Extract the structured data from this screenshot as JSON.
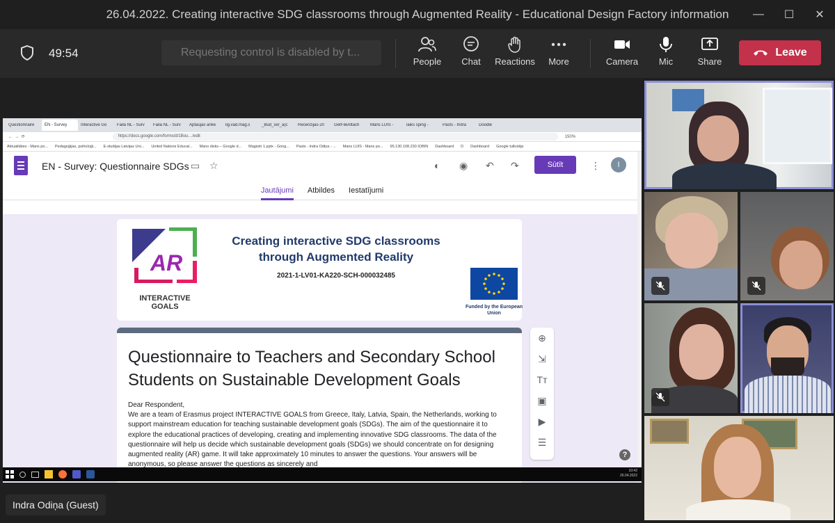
{
  "window": {
    "title": "26.04.2022. Creating interactive SDG classrooms through Augmented Reality - Educational Design Factory information",
    "controls": [
      "—",
      "☐",
      "✕"
    ]
  },
  "meeting": {
    "timer": "49:54",
    "request_control": "Requesting control is disabled by t...",
    "controls": {
      "people": "People",
      "chat": "Chat",
      "reactions": "Reactions",
      "more": "More",
      "camera": "Camera",
      "mic": "Mic",
      "share": "Share",
      "leave": "Leave"
    },
    "presenter_name": "Indra Odiņa (Guest)",
    "colors": {
      "leave": "#c4314b",
      "speaking_outline": "#8b8fd6",
      "bar": "#292929"
    }
  },
  "browser": {
    "tabs": [
      "Questionnaire",
      "EN - Survey",
      "Interactive Go",
      "Faila NL - Surv",
      "Faila NL - Surv",
      "Aptaujas anke",
      "lig.vad.mag.s",
      "_Bud_ser_a(c",
      "Recenzijas-20",
      "GetFileAttach",
      "Mans LUIS - ",
      "laiks sping -",
      "Pasts - Indra",
      "Doodle"
    ],
    "url": "https://docs.google.com/forms/d/1Bou…/edit",
    "zoom": "150%",
    "bookmarks": [
      "Aktualitātes - Mans po...",
      "Pedagoģijas, psiholoģi...",
      "E-studijas Latvijas Uni...",
      "United Nations Educat...",
      "Mans disks – Google d...",
      "Magistri 1.pptx - Goog...",
      "Pasts - Indra Odiņa - ...",
      "Mans LUIS - Mans po...",
      "95.130.108.230 IOBIN",
      "Dashboard",
      "D",
      "Dashboard",
      "Google tulkotājs"
    ]
  },
  "form": {
    "doc_title": "EN - Survey: Questionnaire SDGs",
    "send_label": "Sūtīt",
    "avatar_letter": "I",
    "tabs": [
      "Jautājumi",
      "Atbildes",
      "Iestatījumi"
    ],
    "active_tab": "Jautājumi",
    "banner": {
      "headline": "Creating interactive SDG classrooms through Augmented Reality",
      "project_code": "2021-1-LV01-KA220-SCH-000032485",
      "logo_text": "INTERACTIVE GOALS",
      "eu_text": "Funded by the European Union"
    },
    "title": "Questionnaire to Teachers and Secondary School Students on Sustainable Development Goals",
    "greeting": "Dear Respondent,",
    "description": "We are a team of Erasmus project INTERACTIVE GOALS from Greece, Italy, Latvia, Spain, the Netherlands, working to support mainstream education for teaching sustainable development goals (SDGs). The aim of the questionnaire it to explore the educational practices of developing, creating and implementing innovative SDG classrooms. The data of the questionnaire will help us decide which sustainable development goals (SDGs) we should concentrate on for designing augmented reality (AR) game. It will take approximately 10 minutes to answer the questions. Your answers will be anonymous, so please answer the questions as sincerely and",
    "help": "?",
    "colors": {
      "accent": "#673ab7",
      "background": "#eee9f6",
      "banner_text": "#213a6b"
    }
  },
  "taskbar": {
    "time": "10:42",
    "date": "26.04.2022"
  },
  "participants": [
    {
      "id": "p1",
      "muted": false,
      "speaking": true
    },
    {
      "id": "p2",
      "muted": true,
      "speaking": false
    },
    {
      "id": "p3",
      "muted": true,
      "speaking": false
    },
    {
      "id": "p4",
      "muted": true,
      "speaking": false
    },
    {
      "id": "p5",
      "muted": false,
      "speaking": true
    },
    {
      "id": "p6",
      "muted": false,
      "speaking": false
    }
  ]
}
